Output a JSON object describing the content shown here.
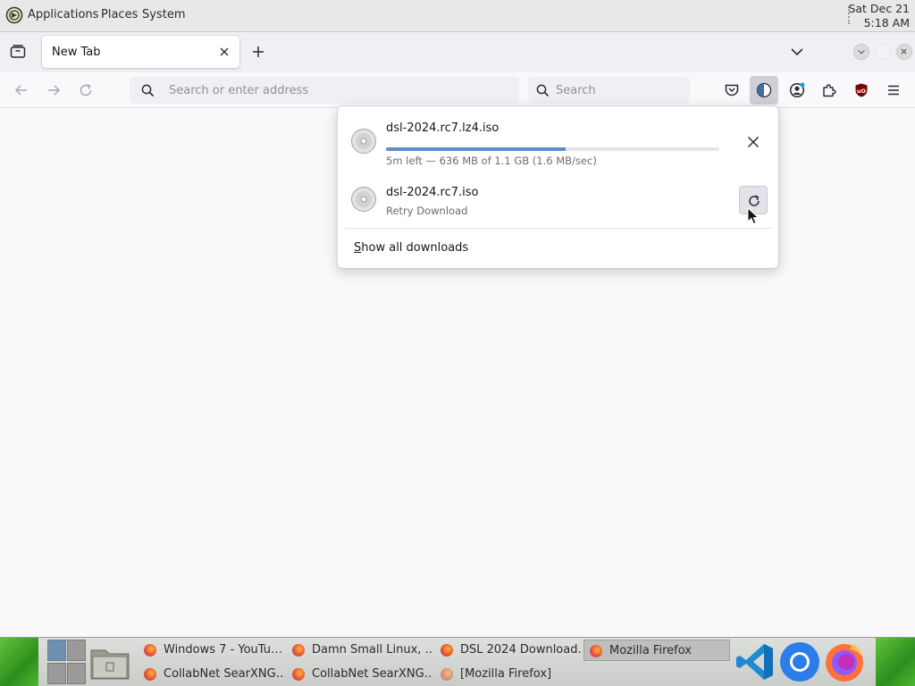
{
  "system_panel": {
    "menus": [
      "Applications",
      "Places",
      "System"
    ],
    "clock": {
      "date": "Sat Dec 21",
      "time": "5:18 AM"
    }
  },
  "tabs": {
    "active_tab_title": "New Tab"
  },
  "navbar": {
    "address_placeholder": "Search or enter address",
    "search_placeholder": "Search"
  },
  "downloads_panel": {
    "items": [
      {
        "filename": "dsl-2024.rc7.lz4.iso",
        "status": "5m left — 636 MB of 1.1 GB (1.6 MB/sec)",
        "progress_percent": 54,
        "action": "cancel"
      },
      {
        "filename": "dsl-2024.rc7.iso",
        "status": "Retry Download",
        "action": "retry"
      }
    ],
    "show_all_access_key": "S",
    "show_all_rest": "how all downloads"
  },
  "taskbar": {
    "tasks": [
      {
        "label": "Windows 7 - YouTu…",
        "active": false
      },
      {
        "label": "Damn Small Linux, …",
        "active": false
      },
      {
        "label": "DSL 2024 Download…",
        "active": false
      },
      {
        "label": "Mozilla Firefox",
        "active": true
      },
      {
        "label": "CollabNet SearXNG…",
        "active": false
      },
      {
        "label": "CollabNet SearXNG…",
        "active": false
      },
      {
        "label": "[Mozilla Firefox]",
        "active": false
      }
    ],
    "launchers": [
      "vscode-icon",
      "chromium-icon",
      "firefox-icon"
    ]
  },
  "colors": {
    "progress_fill": "#5f8fc2",
    "grass_green": "#3da526"
  }
}
